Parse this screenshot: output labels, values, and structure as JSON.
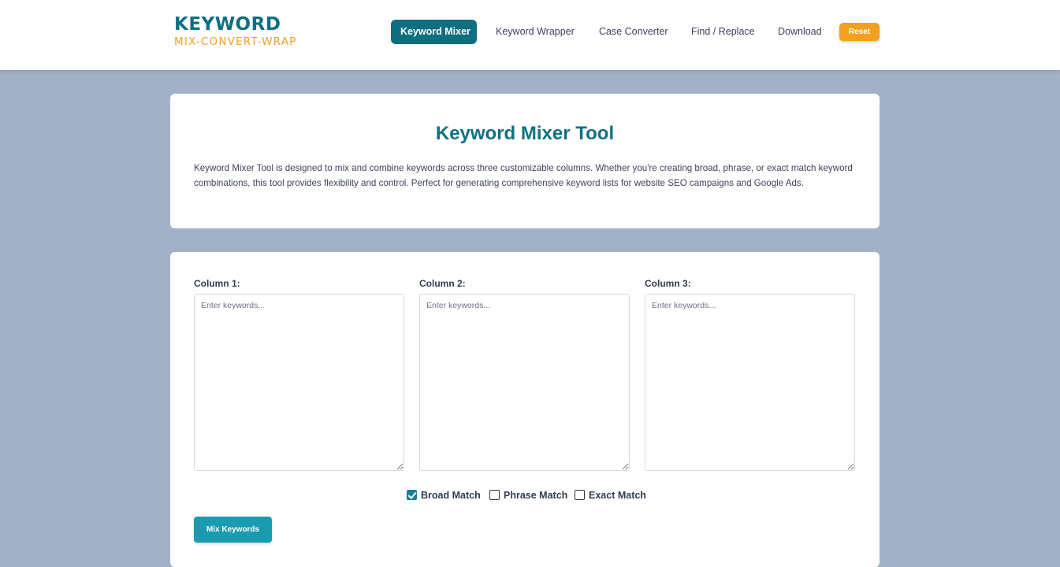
{
  "logo": {
    "word": "KEYWORD",
    "tagline": "MIX-CONVERT-WRAP"
  },
  "nav": {
    "items": [
      {
        "label": "Keyword Mixer",
        "active": true
      },
      {
        "label": "Keyword Wrapper"
      },
      {
        "label": "Case Converter"
      },
      {
        "label": "Find / Replace"
      },
      {
        "label": "Download"
      }
    ],
    "reset_label": "Reset"
  },
  "intro": {
    "title": "Keyword Mixer Tool",
    "description": "Keyword Mixer Tool is designed to mix and combine keywords across three customizable columns. Whether you're creating broad, phrase, or exact match keyword combinations, this tool provides flexibility and control. Perfect for generating comprehensive keyword lists for website SEO campaigns and Google Ads."
  },
  "tool": {
    "columns": [
      {
        "label": "Column 1:",
        "placeholder": "Enter keywords..."
      },
      {
        "label": "Column 2:",
        "placeholder": "Enter keywords..."
      },
      {
        "label": "Column 3:",
        "placeholder": "Enter keywords..."
      }
    ],
    "matches": [
      {
        "label": "Broad Match",
        "checked": true
      },
      {
        "label": "Phrase Match",
        "checked": false
      },
      {
        "label": "Exact Match",
        "checked": false
      }
    ],
    "mix_button": "Mix Keywords"
  },
  "colors": {
    "brand_teal": "#0f6f82",
    "accent_orange": "#f3a01e",
    "page_bg": "#a3b1c6"
  }
}
